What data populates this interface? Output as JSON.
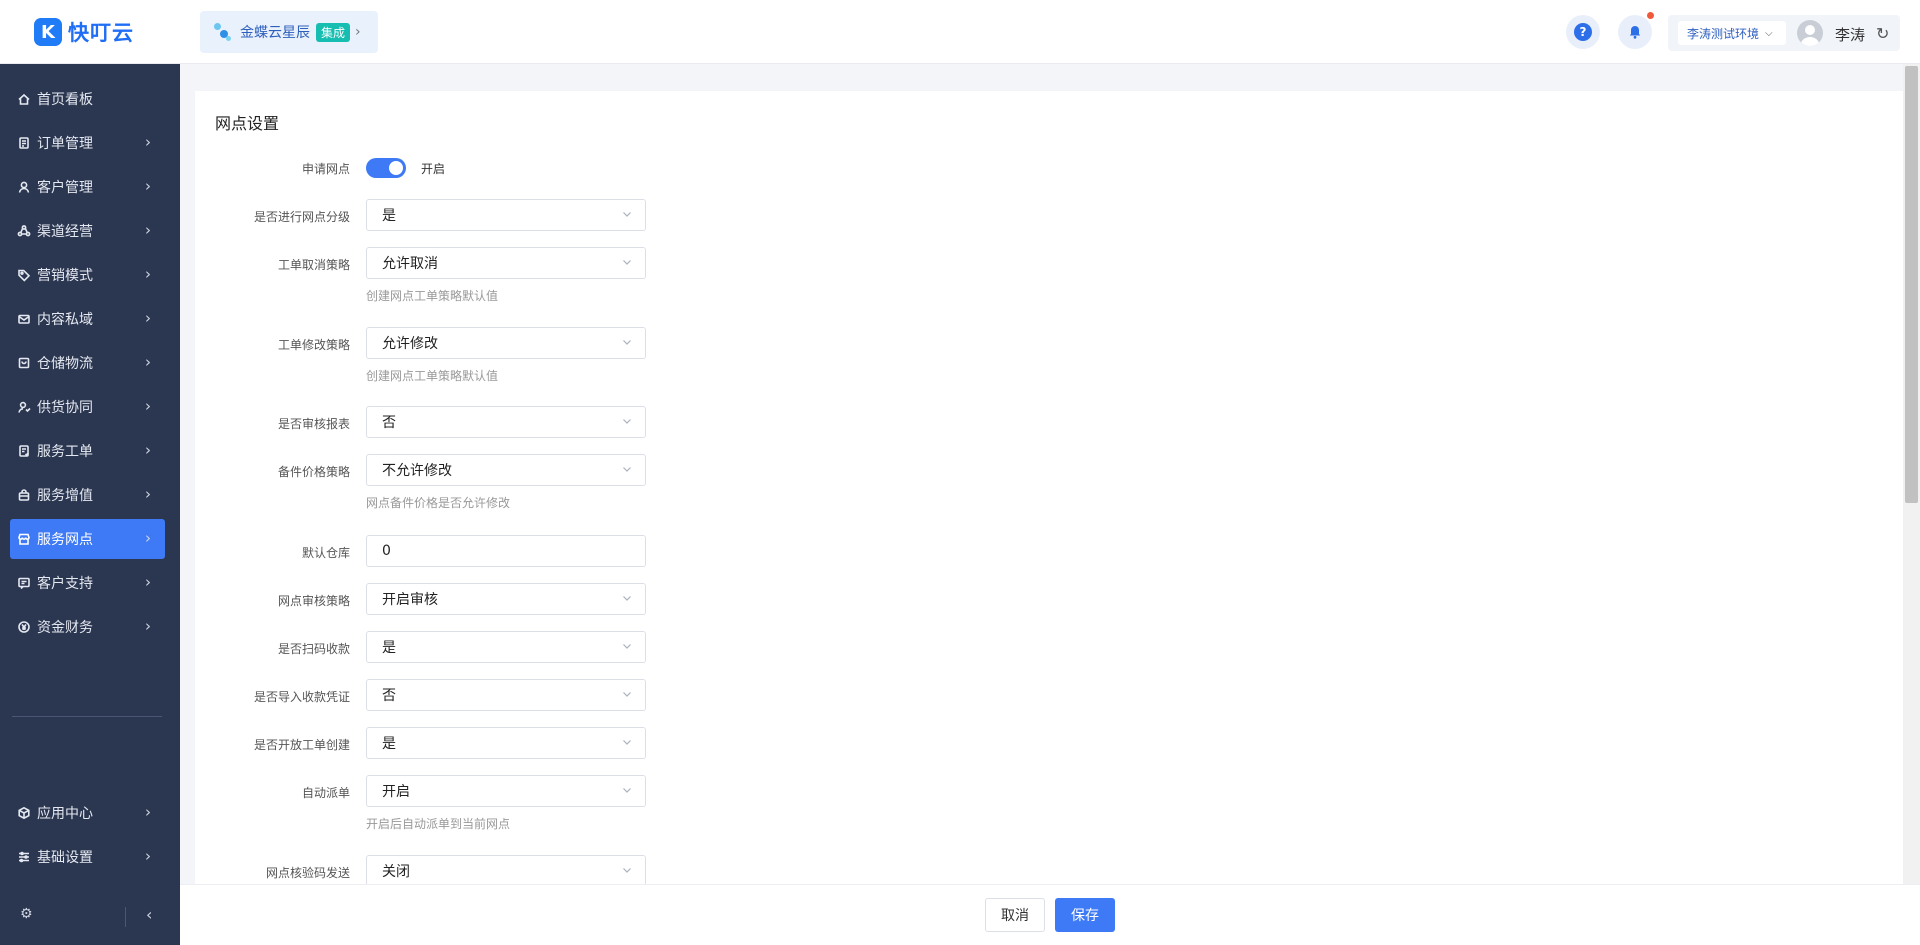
{
  "header": {
    "logo_mark": "K",
    "logo_text": "快叮云",
    "integration_name": "金蝶云星辰",
    "integration_badge": "集成",
    "environment": "李涛测试环境",
    "user_name": "李涛"
  },
  "sidebar": {
    "items": [
      {
        "label": "首页看板",
        "icon": "home-icon"
      },
      {
        "label": "订单管理",
        "icon": "order-icon"
      },
      {
        "label": "客户管理",
        "icon": "user-icon"
      },
      {
        "label": "渠道经营",
        "icon": "channel-icon"
      },
      {
        "label": "营销模式",
        "icon": "tag-icon"
      },
      {
        "label": "内容私域",
        "icon": "mail-icon"
      },
      {
        "label": "仓储物流",
        "icon": "box-icon"
      },
      {
        "label": "供货协同",
        "icon": "supply-icon"
      },
      {
        "label": "服务工单",
        "icon": "ticket-icon"
      },
      {
        "label": "服务增值",
        "icon": "bag-icon"
      },
      {
        "label": "服务网点",
        "icon": "store-icon",
        "active": true
      },
      {
        "label": "客户支持",
        "icon": "support-icon"
      },
      {
        "label": "资金财务",
        "icon": "yen-icon"
      }
    ],
    "bottom_items": [
      {
        "label": "应用中心",
        "icon": "cube-icon"
      },
      {
        "label": "基础设置",
        "icon": "sliders-icon"
      }
    ]
  },
  "page": {
    "title": "网点设置",
    "apply_label": "申请网点",
    "apply_toggle_on": true,
    "apply_toggle_text": "开启",
    "fields": [
      {
        "label": "是否进行网点分级",
        "value": "是"
      },
      {
        "label": "工单取消策略",
        "value": "允许取消",
        "hint": "创建网点工单策略默认值"
      },
      {
        "label": "工单修改策略",
        "value": "允许修改",
        "hint": "创建网点工单策略默认值"
      },
      {
        "label": "是否审核报表",
        "value": "否"
      },
      {
        "label": "备件价格策略",
        "value": "不允许修改",
        "hint": "网点备件价格是否允许修改"
      },
      {
        "label": "默认仓库",
        "value": "0"
      },
      {
        "label": "网点审核策略",
        "value": "开启审核"
      },
      {
        "label": "是否扫码收款",
        "value": "是"
      },
      {
        "label": "是否导入收款凭证",
        "value": "否"
      },
      {
        "label": "是否开放工单创建",
        "value": "是"
      },
      {
        "label": "自动派单",
        "value": "开启",
        "hint": "开启后自动派单到当前网点"
      },
      {
        "label": "网点核验码发送",
        "value": "关闭"
      }
    ]
  },
  "footer": {
    "cancel_label": "取消",
    "save_label": "保存"
  },
  "colors": {
    "accent": "#3e7af5",
    "sidebar_bg": "#2b3650",
    "integration_badge": "#16bdb1"
  }
}
